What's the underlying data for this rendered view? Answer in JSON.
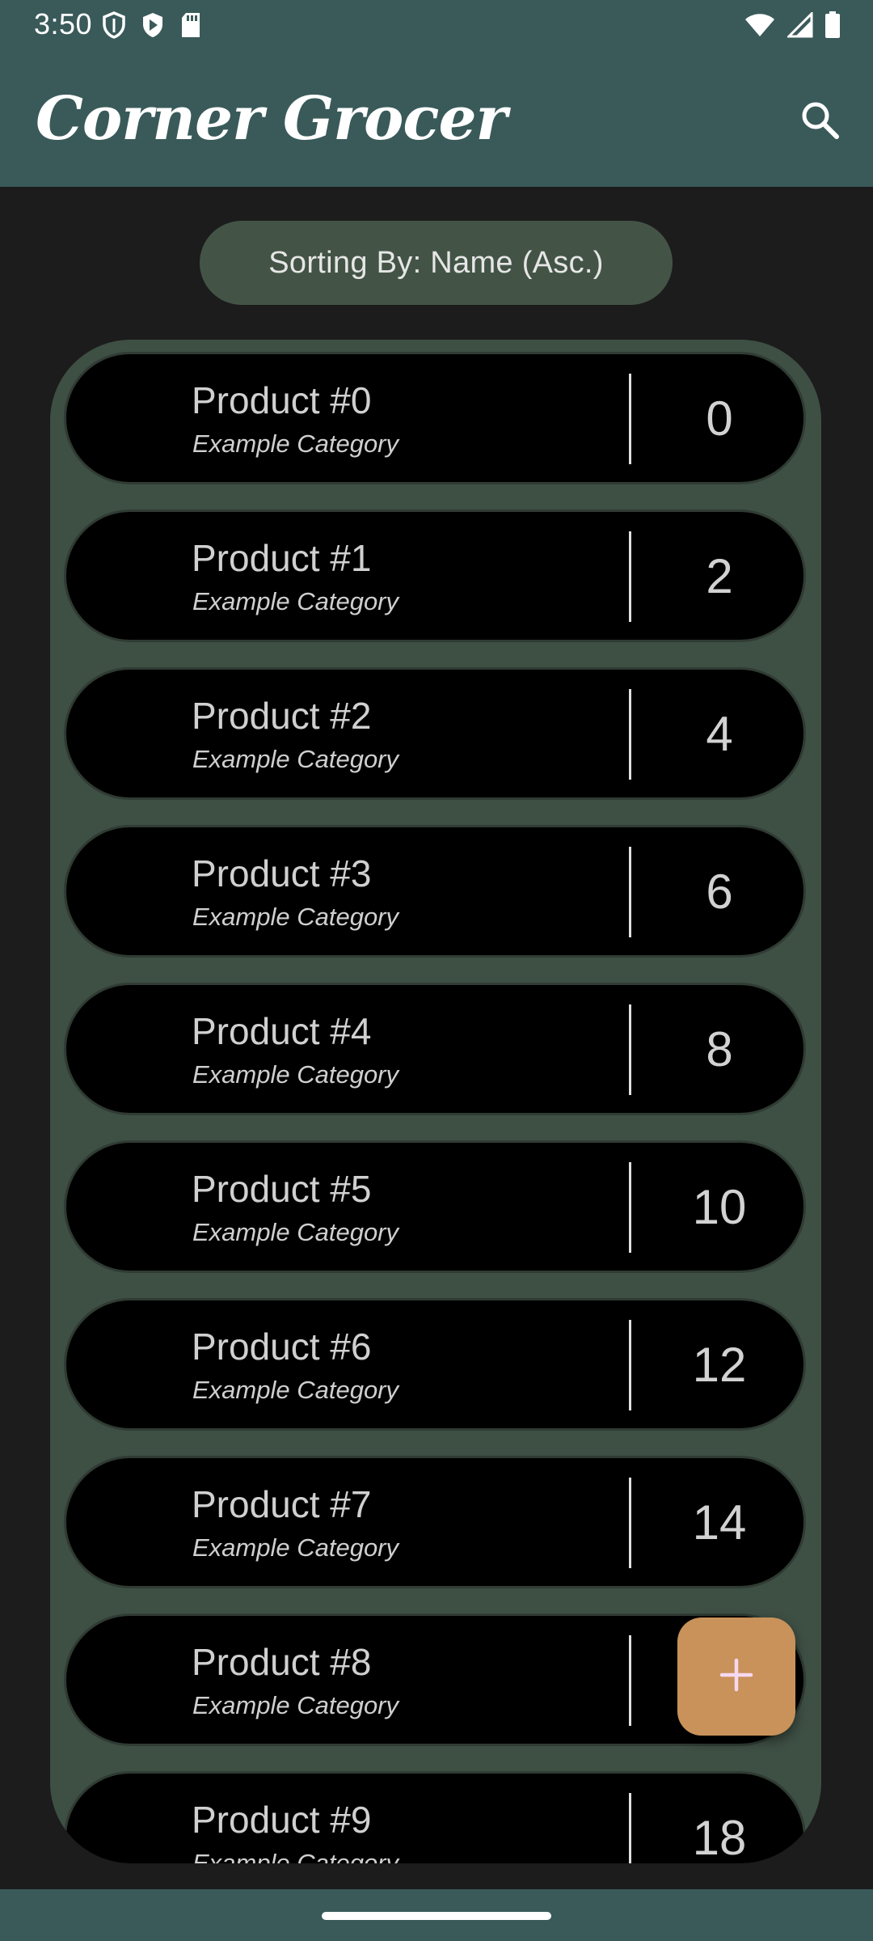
{
  "status_bar": {
    "time": "3:50",
    "left_icons": [
      "shield-icon",
      "play-badge-icon",
      "sd-card-icon"
    ],
    "right_icons": [
      "wifi-icon",
      "signal-icon",
      "battery-icon"
    ]
  },
  "app_bar": {
    "title": "Corner Grocer",
    "search_icon": "search-icon",
    "background_color": "#3a5a5a"
  },
  "sort_chip": {
    "label": "Sorting By: Name (Asc.)"
  },
  "products": [
    {
      "name": "Product #0",
      "category": "Example Category",
      "quantity": "0"
    },
    {
      "name": "Product #1",
      "category": "Example Category",
      "quantity": "2"
    },
    {
      "name": "Product #2",
      "category": "Example Category",
      "quantity": "4"
    },
    {
      "name": "Product #3",
      "category": "Example Category",
      "quantity": "6"
    },
    {
      "name": "Product #4",
      "category": "Example Category",
      "quantity": "8"
    },
    {
      "name": "Product #5",
      "category": "Example Category",
      "quantity": "10"
    },
    {
      "name": "Product #6",
      "category": "Example Category",
      "quantity": "12"
    },
    {
      "name": "Product #7",
      "category": "Example Category",
      "quantity": "14"
    },
    {
      "name": "Product #8",
      "category": "Example Category",
      "quantity": ""
    },
    {
      "name": "Product #9",
      "category": "Example Category",
      "quantity": "18"
    }
  ],
  "fab": {
    "icon": "plus-icon",
    "color": "#c8925a"
  },
  "colors": {
    "panel": "#3e4f44",
    "chip": "#435446",
    "background": "#1c1c1c"
  }
}
